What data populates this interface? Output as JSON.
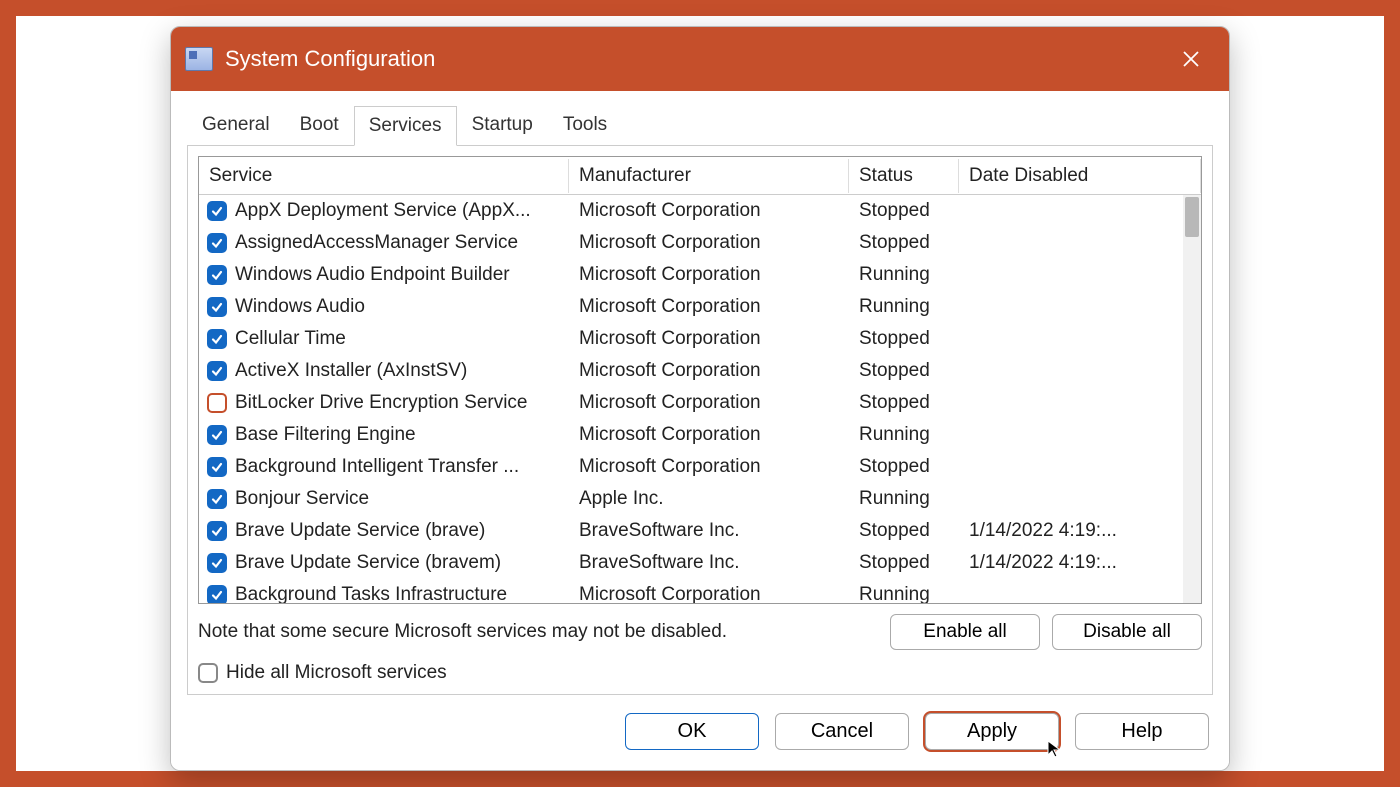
{
  "window": {
    "title": "System Configuration"
  },
  "tabs": [
    "General",
    "Boot",
    "Services",
    "Startup",
    "Tools"
  ],
  "active_tab": 2,
  "columns": [
    "Service",
    "Manufacturer",
    "Status",
    "Date Disabled"
  ],
  "services": [
    {
      "checked": true,
      "name": "AppX Deployment Service (AppX...",
      "manufacturer": "Microsoft Corporation",
      "status": "Stopped",
      "date_disabled": ""
    },
    {
      "checked": true,
      "name": "AssignedAccessManager Service",
      "manufacturer": "Microsoft Corporation",
      "status": "Stopped",
      "date_disabled": ""
    },
    {
      "checked": true,
      "name": "Windows Audio Endpoint Builder",
      "manufacturer": "Microsoft Corporation",
      "status": "Running",
      "date_disabled": ""
    },
    {
      "checked": true,
      "name": "Windows Audio",
      "manufacturer": "Microsoft Corporation",
      "status": "Running",
      "date_disabled": ""
    },
    {
      "checked": true,
      "name": "Cellular Time",
      "manufacturer": "Microsoft Corporation",
      "status": "Stopped",
      "date_disabled": ""
    },
    {
      "checked": true,
      "name": "ActiveX Installer (AxInstSV)",
      "manufacturer": "Microsoft Corporation",
      "status": "Stopped",
      "date_disabled": ""
    },
    {
      "checked": false,
      "name": "BitLocker Drive Encryption Service",
      "manufacturer": "Microsoft Corporation",
      "status": "Stopped",
      "date_disabled": ""
    },
    {
      "checked": true,
      "name": "Base Filtering Engine",
      "manufacturer": "Microsoft Corporation",
      "status": "Running",
      "date_disabled": ""
    },
    {
      "checked": true,
      "name": "Background Intelligent Transfer ...",
      "manufacturer": "Microsoft Corporation",
      "status": "Stopped",
      "date_disabled": ""
    },
    {
      "checked": true,
      "name": "Bonjour Service",
      "manufacturer": "Apple Inc.",
      "status": "Running",
      "date_disabled": ""
    },
    {
      "checked": true,
      "name": "Brave Update Service (brave)",
      "manufacturer": "BraveSoftware Inc.",
      "status": "Stopped",
      "date_disabled": "1/14/2022 4:19:..."
    },
    {
      "checked": true,
      "name": "Brave Update Service (bravem)",
      "manufacturer": "BraveSoftware Inc.",
      "status": "Stopped",
      "date_disabled": "1/14/2022 4:19:..."
    },
    {
      "checked": true,
      "name": "Background Tasks Infrastructure",
      "manufacturer": "Microsoft Corporation",
      "status": "Running",
      "date_disabled": ""
    }
  ],
  "note": "Note that some secure Microsoft services may not be disabled.",
  "hide_label": "Hide all Microsoft services",
  "hide_checked": false,
  "actions": {
    "enable_all": "Enable all",
    "disable_all": "Disable all"
  },
  "buttons": {
    "ok": "OK",
    "cancel": "Cancel",
    "apply": "Apply",
    "help": "Help"
  }
}
